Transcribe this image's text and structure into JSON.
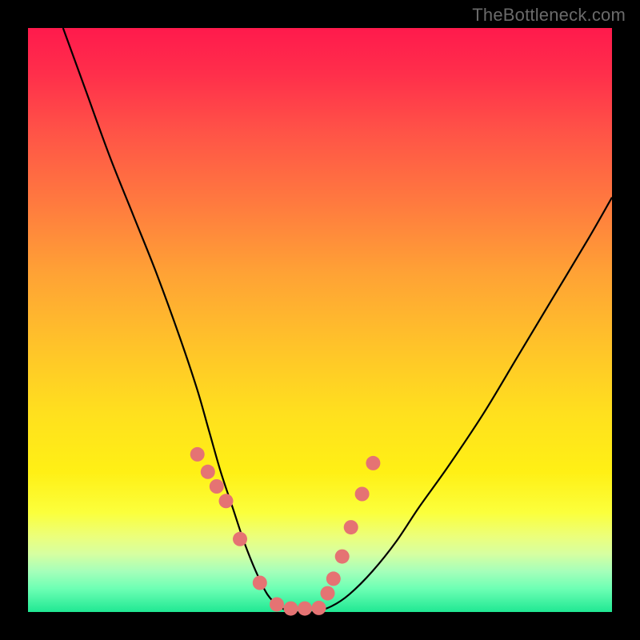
{
  "watermark": "TheBottleneck.com",
  "colors": {
    "background": "#000000",
    "curve_stroke": "#000000",
    "marker_fill": "#e57373",
    "marker_stroke": "#c85e5e"
  },
  "chart_data": {
    "type": "line",
    "title": "",
    "xlabel": "",
    "ylabel": "",
    "xlim": [
      0,
      100
    ],
    "ylim": [
      0,
      100
    ],
    "grid": false,
    "legend": false,
    "series": [
      {
        "name": "curve",
        "x": [
          6,
          10,
          14,
          18,
          22,
          26,
          29,
          31,
          33,
          35,
          37,
          39,
          41,
          43,
          45,
          47,
          49,
          52,
          55,
          59,
          63,
          67,
          72,
          78,
          84,
          90,
          96,
          100
        ],
        "values": [
          100,
          89,
          78,
          68,
          58,
          47,
          38,
          31,
          24,
          18,
          12,
          7,
          3,
          1,
          0,
          0,
          0,
          1,
          3,
          7,
          12,
          18,
          25,
          34,
          44,
          54,
          64,
          71
        ]
      }
    ],
    "markers": {
      "name": "highlight-points",
      "x": [
        29.0,
        30.8,
        32.3,
        33.9,
        36.3,
        39.7,
        42.6,
        45.0,
        47.4,
        49.8,
        51.3,
        52.3,
        53.8,
        55.3,
        57.2,
        59.1
      ],
      "values": [
        27.0,
        24.0,
        21.5,
        19.0,
        12.5,
        5.0,
        1.3,
        0.6,
        0.6,
        0.7,
        3.2,
        5.7,
        9.5,
        14.5,
        20.2,
        25.5
      ]
    }
  }
}
